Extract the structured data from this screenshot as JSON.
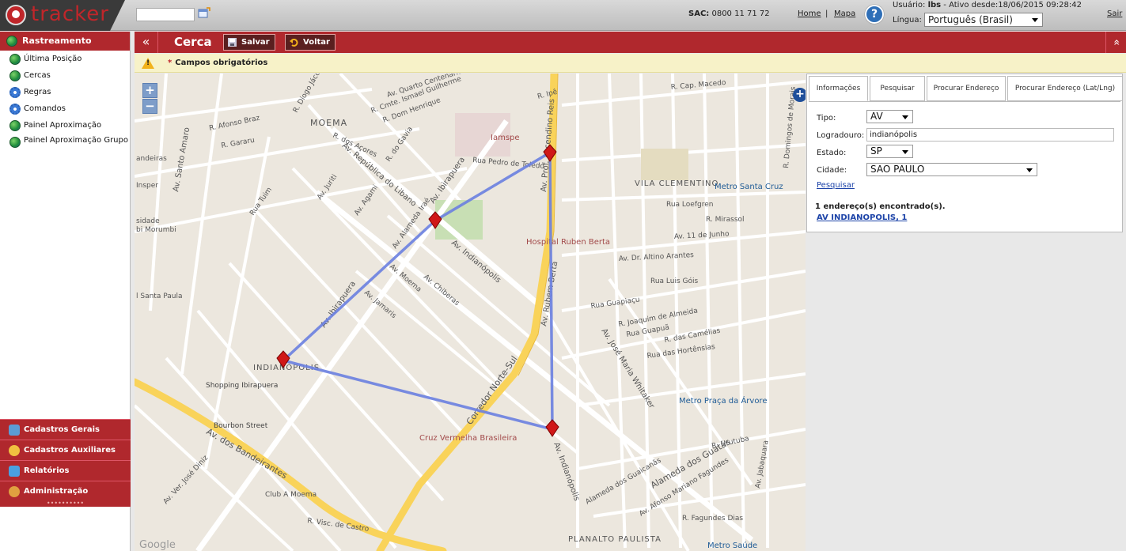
{
  "app": {
    "logo_text": "tracker",
    "sac_label": "SAC:",
    "sac_phone": "0800 11 71 72",
    "nav_home": "Home",
    "nav_sep": "|",
    "nav_mapa": "Mapa",
    "help": "?",
    "user_label": "Usuário:",
    "user_name": "lbs",
    "active_since": " - Ativo desde:18/06/2015 09:28:42",
    "lang_label": "Língua:",
    "lang_value": "Português (Brasil)",
    "logout": "Sair"
  },
  "sidebar": {
    "header": "Rastreamento",
    "items": [
      {
        "label": "Última Posição"
      },
      {
        "label": "Cercas"
      },
      {
        "label": "Regras"
      },
      {
        "label": "Comandos"
      },
      {
        "label": "Painel Aproximação"
      },
      {
        "label": "Painel Aproximação Grupo"
      }
    ],
    "footer": [
      {
        "label": "Cadastros Gerais"
      },
      {
        "label": "Cadastros Auxiliares"
      },
      {
        "label": "Relatórios"
      },
      {
        "label": "Administração"
      }
    ],
    "grip": "••••••••••"
  },
  "content": {
    "collapse_left": "«",
    "title": "Cerca",
    "save_label": "Salvar",
    "back_label": "Voltar",
    "collapse_top": "«",
    "required_star": "*",
    "required_text": "Campos obrigatórios"
  },
  "map": {
    "zoom_in": "+",
    "zoom_out": "−",
    "add": "+",
    "watermark": "Google",
    "labels": {
      "av_quarto_centenario": "Av. Quarto Centenário",
      "r_cmte_ismael": "R. Cmte. Ismael Guilherme",
      "r_dom_henrique": "R. Dom Henrique",
      "r_diogo_jacome": "R. Diogo Jácome",
      "r_afonso_braz": "R. Afonso Braz",
      "moema": "MOEMA",
      "r_dos_acores": "R. dos Açores",
      "r_do_gavia": "R. do Gavia",
      "r_gararu": "R. Gararu",
      "av_republica_libano": "Av. República do Libano",
      "av_ibirapuera_top": "Av. Ibirapuera",
      "av_santo_amaro": "Av. Santo Amaro",
      "insper": "Insper",
      "andeiras": "andeiras",
      "sidade": "sidade",
      "bi_morumbi": "bi Morumbi",
      "santa_paula": "l Santa Paula",
      "rua_tuim": "Rua Tuim",
      "av_jurucê": "Av. Juriti",
      "av_agami": "Av. Agami",
      "al_irae": "Av. Alameda Iraé",
      "av_indianopolis_mid": "Av. Indianópolis",
      "av_moema": "Av. Moema",
      "av_chiberas": "Av. Chiberas",
      "av_jamaris": "Av. Jamaris",
      "av_ibirapuera_mid": "Av. Ibirapuera",
      "indianopolis_area": "INDIANÓPOLIS",
      "shopping_ibirapuera": "Shopping Ibirapuera",
      "av_dos_bandeirantes": "Av. dos Bandeirantes",
      "bourbon_street": "Bourbon Street",
      "corredor_norte_sul": "Corredor Norte-Sul",
      "av_rubem_berta": "Av. Rubem Berta",
      "hospital_ruben_berta": "Hospital Ruben Berta",
      "iamspe": "Iamspe",
      "rua_pedro_toledo": "Rua Pedro de Toledo",
      "av_prof_ascendino": "Av. Prof. Ascendino Reis",
      "r_cap_macedo": "R. Cap. Macedo",
      "r_ipe": "R. Ipê",
      "vila_clementino": "VILA CLEMENTINO",
      "metro_santa_cruz": "Metro Santa Cruz",
      "rua_loefgren": "Rua Loefgren",
      "r_mirassol": "R. Mirassol",
      "av_11_junho": "Av. 11 de Junho",
      "av_dr_altino": "Av. Dr. Altino Arantes",
      "rua_luis_gois": "Rua Luis Góis",
      "rua_guapiacu": "Rua Guapiaçu",
      "r_joaquim_almeida": "R. Joaquim de Almeida",
      "rua_guapua": "Rua Guapuã",
      "r_camelias": "R. das Camélias",
      "rua_hortensias": "Rua das Hortênsias",
      "av_jose_maria_whitaker": "Av. José Maria Whitaker",
      "metro_praca_arvore": "Metro Praça da Árvore",
      "cruz_vermelha": "Cruz Vermelha Brasileira",
      "av_indianopolis_low": "Av. Indianópolis",
      "alameda_guaicanas": "Alameda dos Guaicanãs",
      "alameda_guatas": "Alameda dos Guatás",
      "r_urutuba": "R. Urutuba",
      "av_afonso_mariano": "Av. Afonso Mariano Fagundes",
      "r_fagundes_dias": "R. Fagundes Dias",
      "planalto_paulista": "PLANALTO PAULISTA",
      "metro_saude": "Metro Saúde",
      "club_a_moema": "Club A Moema",
      "av_ver_jose_diniz": "Av. Ver. José Diniz",
      "r_visc_castro": "R. Visc. de Castro",
      "av_jabaquara": "Av. Jabaquara",
      "r_domingos_morais": "R. Domingos de Morais"
    }
  },
  "panel": {
    "tabs": [
      {
        "label": "Informações"
      },
      {
        "label": "Pesquisar"
      },
      {
        "label": "Procurar Endereço"
      },
      {
        "label": "Procurar Endereço (Lat/Lng)"
      }
    ],
    "tipo_label": "Tipo:",
    "tipo_value": "AV",
    "logradouro_label": "Logradouro:",
    "logradouro_value": "indianópolis",
    "estado_label": "Estado:",
    "estado_value": "SP",
    "cidade_label": "Cidade:",
    "cidade_value": "SAO PAULO",
    "search_link": "Pesquisar",
    "result_count": "1 endereço(s) encontrado(s).",
    "result_item": "AV INDIANOPOLIS, 1"
  },
  "colors": {
    "brand_red": "#b0282d",
    "fence_line": "#6a7fe0",
    "marker": "#d01818",
    "road_yellow": "#f9d35a"
  }
}
